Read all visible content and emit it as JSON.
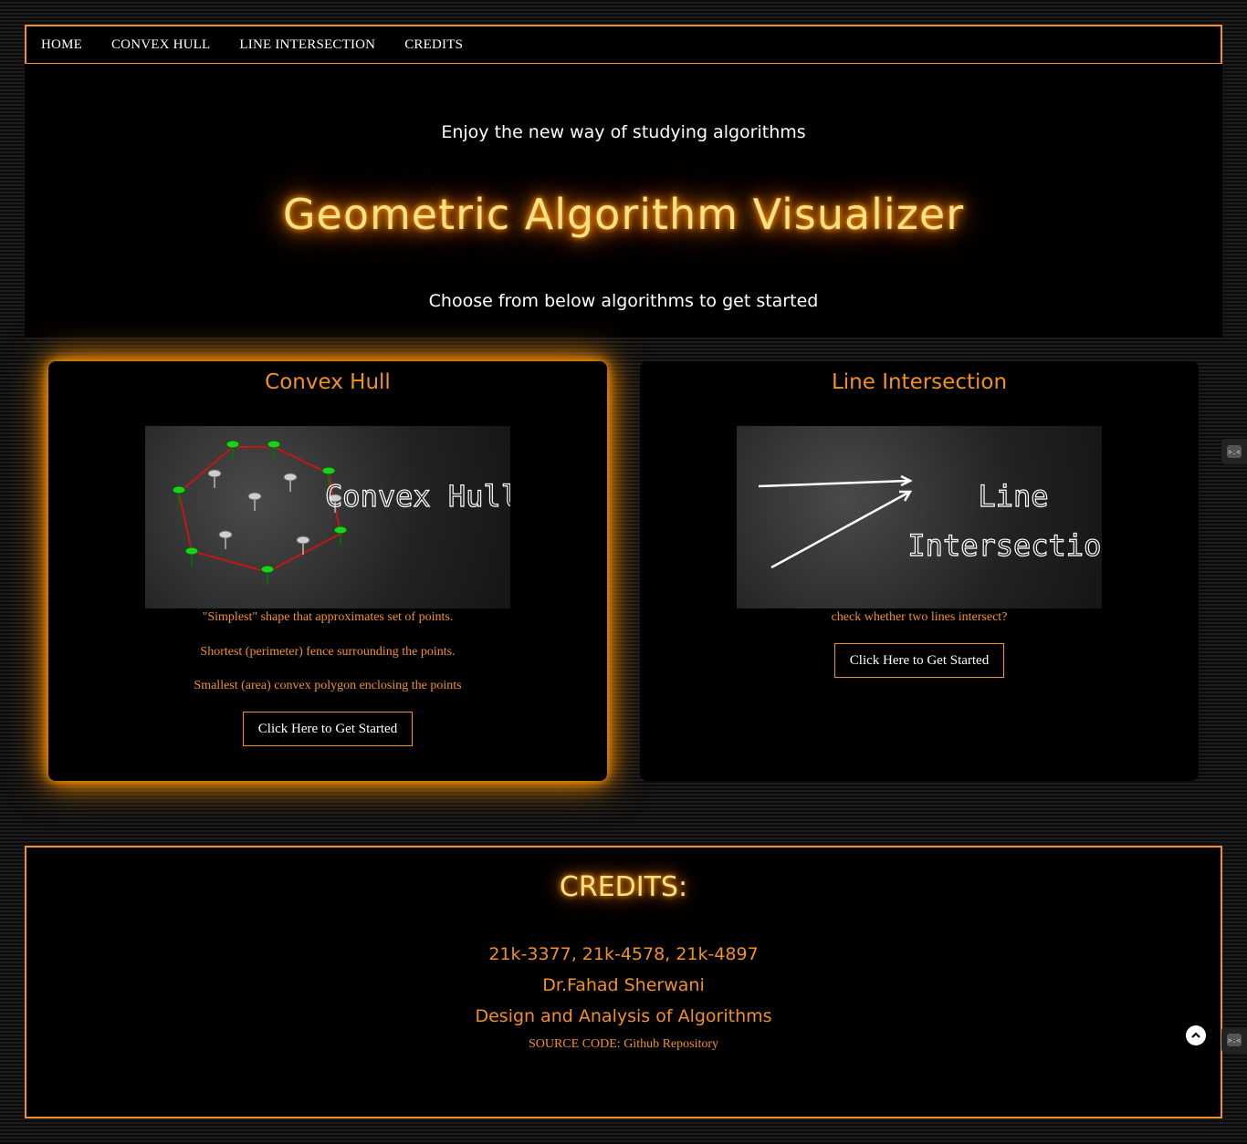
{
  "nav": {
    "items": [
      {
        "label": "HOME"
      },
      {
        "label": "CONVEX HULL"
      },
      {
        "label": "LINE INTERSECTION"
      },
      {
        "label": "CREDITS"
      }
    ]
  },
  "hero": {
    "tagline": "Enjoy the new way of studying algorithms",
    "title": "Geometric Algorithm Visualizer",
    "subtitle": "Choose from below algorithms to get started"
  },
  "cards": {
    "convex": {
      "title": "Convex Hull",
      "image_text": "Convex Hull",
      "desc1": "\"Simplest\" shape that approximates set of points.",
      "desc2": "Shortest (perimeter) fence surrounding the points.",
      "desc3": "Smallest (area) convex polygon enclosing the points",
      "button": "Click Here to Get Started"
    },
    "line": {
      "title": "Line Intersection",
      "image_text_1": "Line",
      "image_text_2": "Intersection",
      "desc1": "check whether two lines intersect?",
      "button": "Click Here to Get Started"
    }
  },
  "credits": {
    "heading": "CREDITS:",
    "ids": "21k-3377, 21k-4578, 21k-4897",
    "instructor": "Dr.Fahad Sherwani",
    "course": "Design and Analysis of Algorithms",
    "source": "SOURCE CODE: Github Repository"
  },
  "colors": {
    "accent": "#f0902a",
    "glow": "#ff8c00",
    "title_text": "#ffe08a"
  },
  "icons": {
    "scroll_top": "chevron-up-icon",
    "side_widget": "extension-icon"
  }
}
